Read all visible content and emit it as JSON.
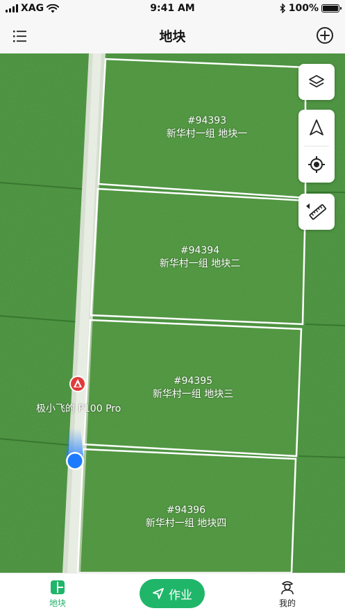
{
  "status_bar": {
    "carrier": "XAG",
    "time": "9:41 AM",
    "battery_text": "100%",
    "battery_level": 1.0
  },
  "nav": {
    "title": "地块",
    "menu_icon": "list-icon",
    "add_icon": "plus-circle-icon"
  },
  "map": {
    "plots": [
      {
        "id": "#94393",
        "name": "新华村一组 地块一"
      },
      {
        "id": "#94394",
        "name": "新华村一组 地块二"
      },
      {
        "id": "#94395",
        "name": "新华村一组 地块三"
      },
      {
        "id": "#94396",
        "name": "新华村一组 地块四"
      }
    ],
    "drone_name": "极小飞的 P100 Pro",
    "controls": [
      "layers-icon",
      "navigation-arrow-icon",
      "locate-target-icon",
      "ruler-icon"
    ]
  },
  "tab_bar": {
    "plots_label": "地块",
    "work_label": "作业",
    "mine_label": "我的",
    "active_color": "#20b66a"
  }
}
